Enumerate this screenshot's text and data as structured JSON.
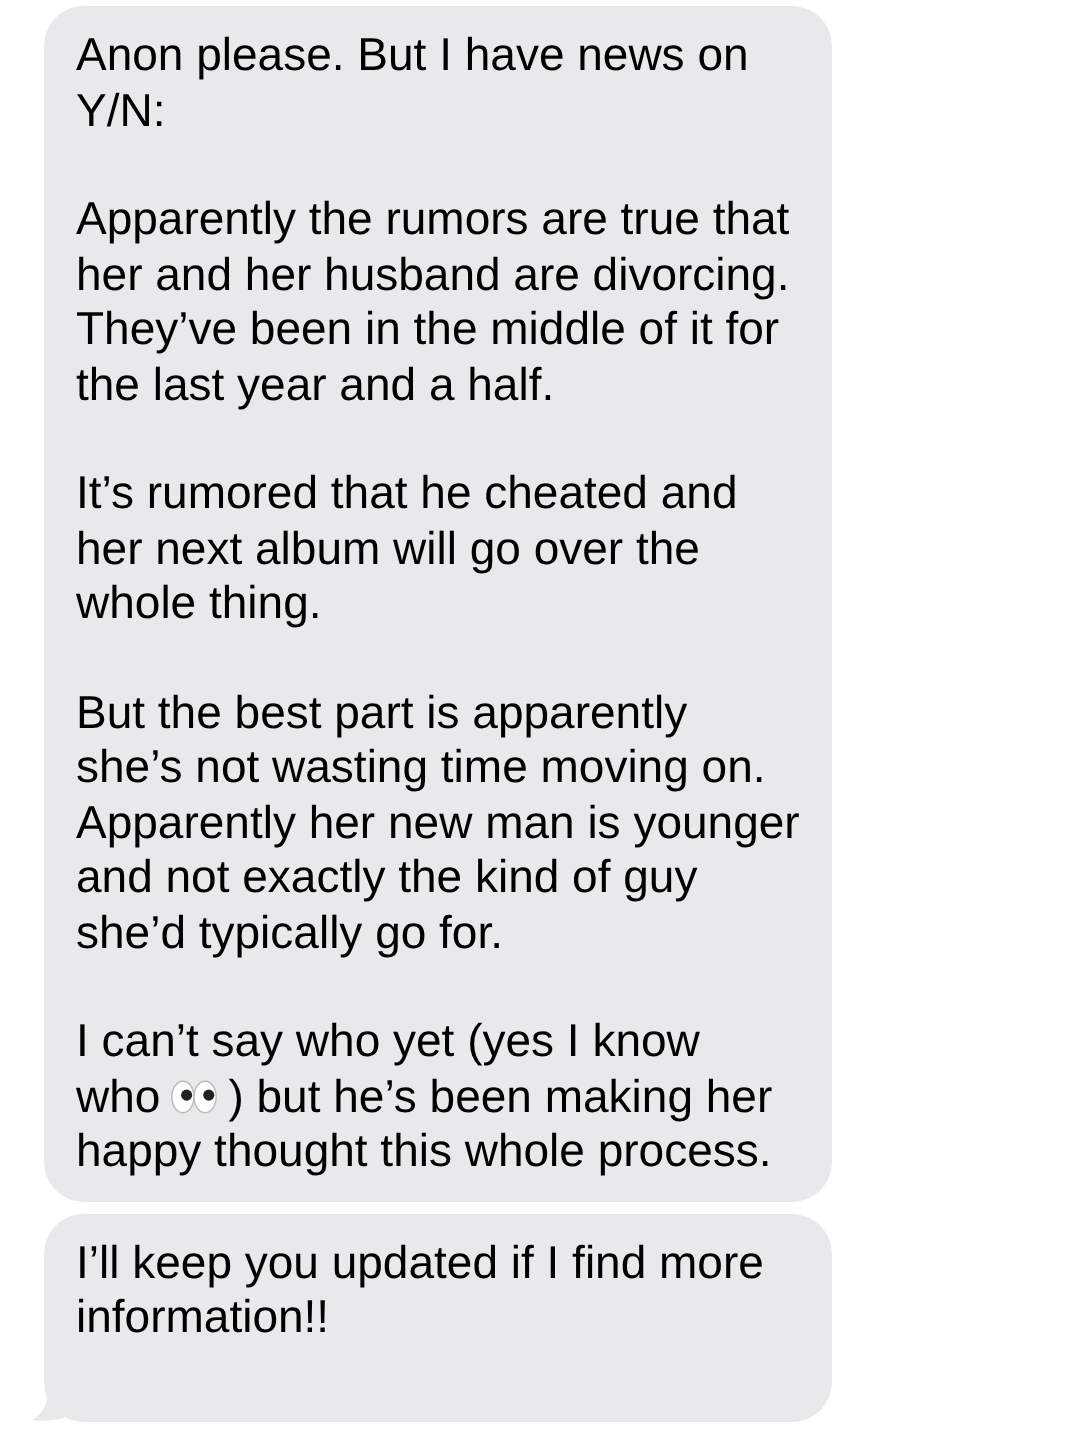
{
  "messages": [
    {
      "tail": false,
      "paragraphs": [
        {
          "kind": "plain",
          "text": "Anon please. But I have news on Y/N:"
        },
        {
          "kind": "plain",
          "text": "Apparently the rumors are true that her and her husband are divorcing. They’ve been in the middle of it for the last year and a half."
        },
        {
          "kind": "plain",
          "text": "It’s rumored that he cheated and her next album will go over the whole thing."
        },
        {
          "kind": "plain",
          "text": "But the best part is apparently she’s not wasting time moving on. Apparently her new man is younger and not exactly the kind of guy she’d typically go for."
        },
        {
          "kind": "with_icon",
          "before": [
            "I can’t say who yet (yes I know",
            "who"
          ],
          "after": [
            ") but he’s been making her",
            "happy thought this whole process."
          ]
        }
      ]
    },
    {
      "tail": true,
      "paragraphs": [
        {
          "kind": "plain",
          "text": "I’ll keep you updated if I find more information!!"
        }
      ]
    }
  ]
}
